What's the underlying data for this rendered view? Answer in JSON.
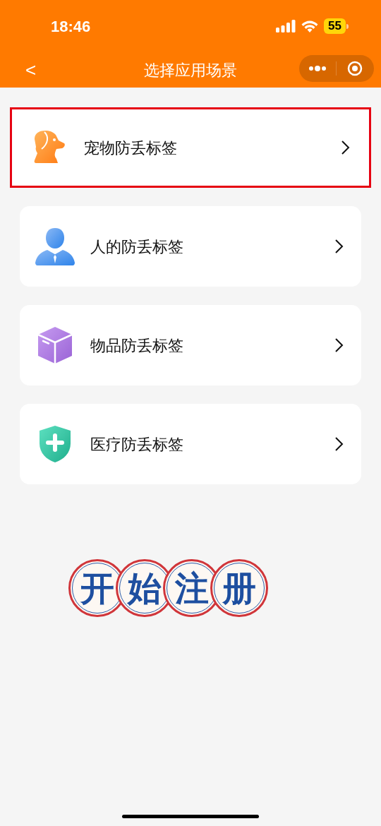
{
  "status_bar": {
    "time": "18:46",
    "battery": "55"
  },
  "nav_bar": {
    "back": "<",
    "title": "选择应用场景"
  },
  "scenes": [
    {
      "kind": "pet",
      "label": "宠物防丢标签",
      "selected": true
    },
    {
      "kind": "person",
      "label": "人的防丢标签",
      "selected": false
    },
    {
      "kind": "item",
      "label": "物品防丢标签",
      "selected": false
    },
    {
      "kind": "medical",
      "label": "医疗防丢标签",
      "selected": false
    }
  ],
  "register_button": {
    "characters": [
      "开",
      "始",
      "注",
      "册"
    ]
  }
}
